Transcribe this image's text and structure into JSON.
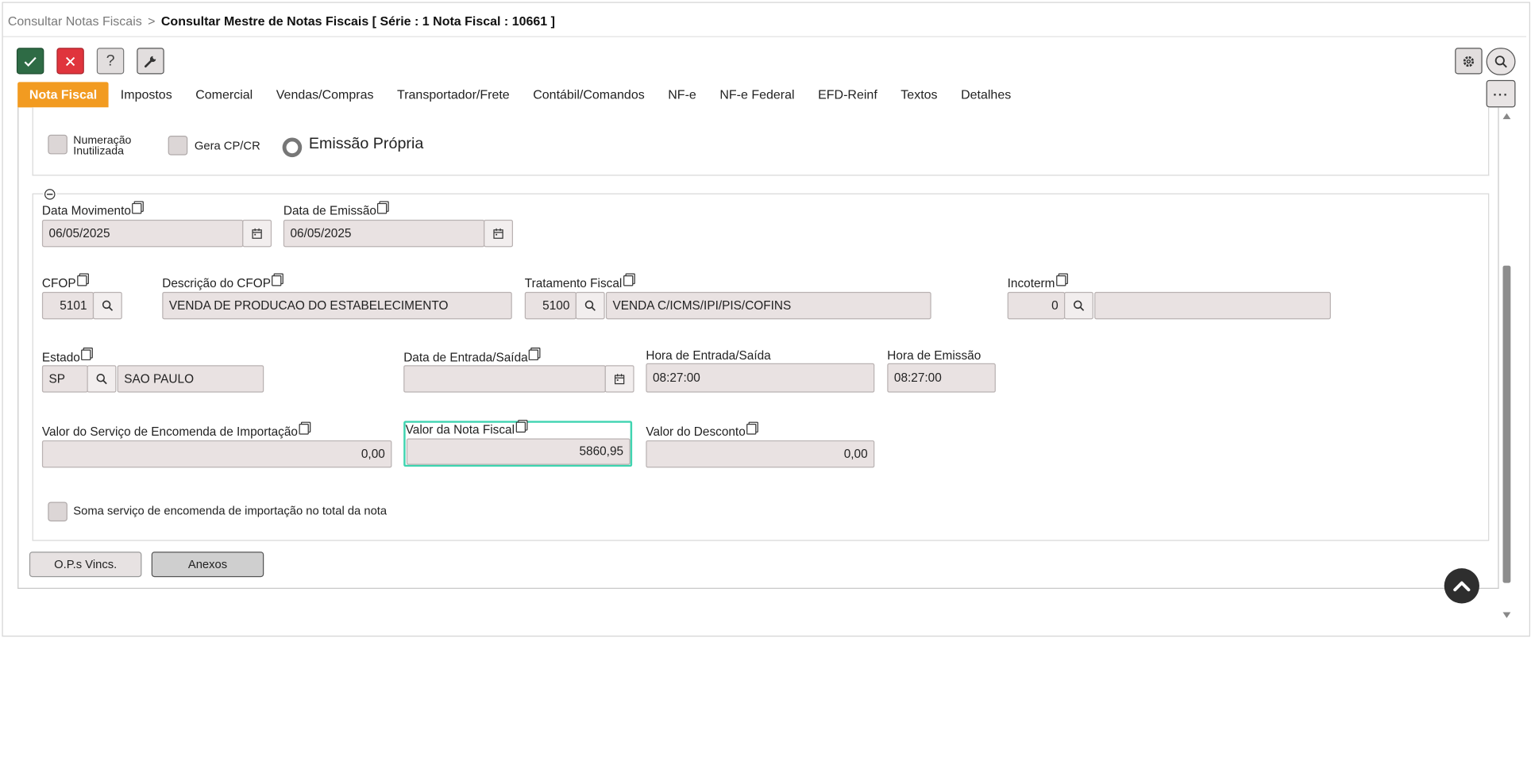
{
  "breadcrumb": {
    "parent": "Consultar Notas Fiscais",
    "separator": ">",
    "current": "Consultar Mestre de Notas Fiscais [ Série : 1 Nota Fiscal : 10661 ]"
  },
  "toolbar": {
    "confirm_icon": "check-icon",
    "cancel_icon": "close-icon",
    "help_label": "?",
    "tools_icon": "wrench-icon",
    "settings_icon": "gear-icon",
    "search_icon": "search-icon",
    "more_label": "···"
  },
  "tabs": [
    {
      "label": "Nota Fiscal",
      "active": true
    },
    {
      "label": "Impostos"
    },
    {
      "label": "Comercial"
    },
    {
      "label": "Vendas/Compras"
    },
    {
      "label": "Transportador/Frete"
    },
    {
      "label": "Contábil/Comandos"
    },
    {
      "label": "NF-e"
    },
    {
      "label": "NF-e Federal"
    },
    {
      "label": "EFD-Reinf"
    },
    {
      "label": "Textos"
    },
    {
      "label": "Detalhes"
    }
  ],
  "flags": {
    "numeracao_inutilizada_line1": "Numeração",
    "numeracao_inutilizada_line2": "Inutilizada",
    "gera_cp_cr": "Gera CP/CR",
    "emissao_propria": "Emissão Própria"
  },
  "section": {
    "collapse_icon": "minus-circle-icon"
  },
  "fields": {
    "data_movimento": {
      "label": "Data Movimento",
      "value": "06/05/2025"
    },
    "data_emissao": {
      "label": "Data de Emissão",
      "value": "06/05/2025"
    },
    "cfop": {
      "label": "CFOP",
      "value": "5101"
    },
    "descricao_cfop": {
      "label": "Descrição do CFOP",
      "value": "VENDA DE PRODUCAO DO ESTABELECIMENTO"
    },
    "tratamento_fiscal": {
      "label": "Tratamento Fiscal",
      "code": "5100",
      "value": "VENDA C/ICMS/IPI/PIS/COFINS"
    },
    "incoterm": {
      "label": "Incoterm",
      "code": "0",
      "value": ""
    },
    "estado": {
      "label": "Estado",
      "code": "SP",
      "value": "SAO PAULO"
    },
    "data_entrada_saida": {
      "label": "Data de Entrada/Saída",
      "value": ""
    },
    "hora_entrada_saida": {
      "label": "Hora de Entrada/Saída",
      "value": "08:27:00"
    },
    "hora_emissao": {
      "label": "Hora de Emissão",
      "value": "08:27:00"
    },
    "valor_servico_importacao": {
      "label": "Valor do Serviço de Encomenda de Importação",
      "value": "0,00"
    },
    "valor_nota_fiscal": {
      "label": "Valor da Nota Fiscal",
      "value": "5860,95"
    },
    "valor_desconto": {
      "label": "Valor do Desconto",
      "value": "0,00"
    },
    "soma_servico": {
      "label": "Soma serviço de encomenda de importação no total da nota"
    }
  },
  "buttons": {
    "ops_vincs": "O.P.s Vincs.",
    "anexos": "Anexos"
  },
  "colors": {
    "accent": "#f29b21",
    "confirm": "#2e6b45",
    "cancel": "#e0343d",
    "focus": "#3fd4b0",
    "field_bg": "#e9e2e2"
  }
}
